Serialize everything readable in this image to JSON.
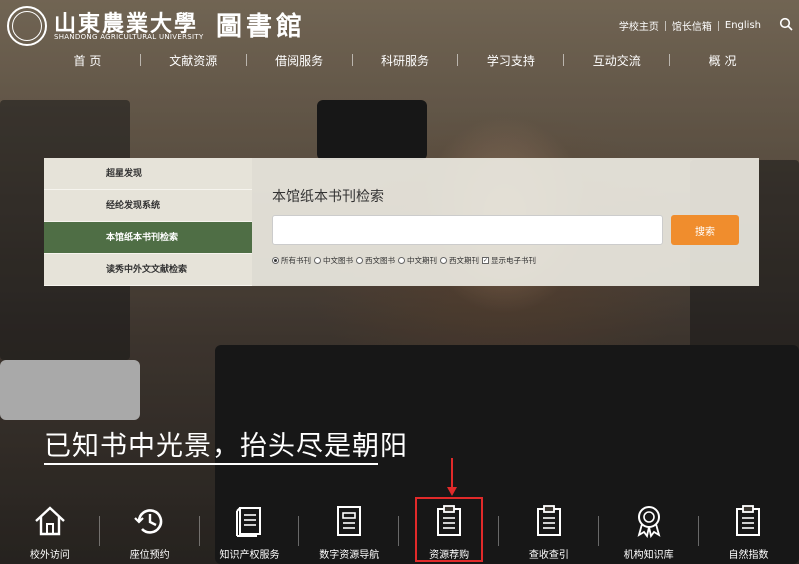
{
  "header": {
    "logo_name": "山東農業大學",
    "logo_sub": "SHANDONG AGRICULTURAL UNIVERSITY",
    "logo_library": "圖書館",
    "top_links": [
      "学校主页",
      "馆长信箱",
      "English"
    ]
  },
  "nav": [
    "首 页",
    "文献资源",
    "借阅服务",
    "科研服务",
    "学习支持",
    "互动交流",
    "概 况"
  ],
  "search_panel": {
    "side_items": [
      "超星发现",
      "经纶发现系统",
      "本馆纸本书刊检索",
      "读秀中外文文献检索"
    ],
    "active_index": 2,
    "title": "本馆纸本书刊检索",
    "search_value": "",
    "search_button": "搜索",
    "radio_options": [
      "所有书刊",
      "中文图书",
      "西文图书",
      "中文期刊",
      "西文期刊"
    ],
    "radio_selected": 0,
    "checkbox_label": "显示电子书刊",
    "checkbox_checked": true
  },
  "slogan": "已知书中光景，抬头尽是朝阳",
  "quick_links": [
    {
      "label": "校外访问",
      "icon": "home-icon"
    },
    {
      "label": "座位预约",
      "icon": "history-clock-icon"
    },
    {
      "label": "知识产权服务",
      "icon": "book-icon"
    },
    {
      "label": "数字资源导航",
      "icon": "document-icon"
    },
    {
      "label": "资源荐购",
      "icon": "clipboard-icon"
    },
    {
      "label": "查收查引",
      "icon": "clipboard-icon"
    },
    {
      "label": "机构知识库",
      "icon": "award-icon"
    },
    {
      "label": "自然指数",
      "icon": "clipboard-icon"
    }
  ],
  "colors": {
    "active_green": "#4f6e45",
    "search_orange": "#f08d2d",
    "highlight_red": "#e12a2a"
  }
}
